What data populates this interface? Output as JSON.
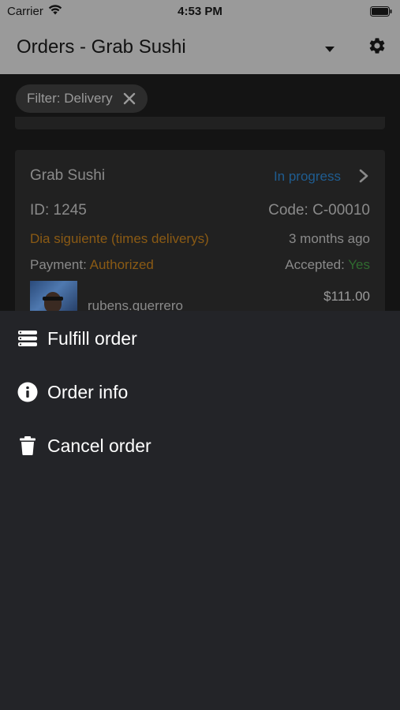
{
  "status_bar": {
    "carrier": "Carrier",
    "time": "4:53 PM"
  },
  "app_bar": {
    "title": "Orders - Grab Sushi",
    "icons": [
      "dropdown-arrow-icon",
      "gear-icon"
    ]
  },
  "filter_chip": {
    "label": "Filter: Delivery"
  },
  "order": {
    "store": "Grab Sushi",
    "status": "In progress",
    "id": "ID: 1245",
    "code": "Code: C-00010",
    "delivery": "Dia siguiente (times deliverys)",
    "time_ago": "3 months ago",
    "payment_label": "Payment:",
    "payment_value": "Authorized",
    "accepted_label": "Accepted:",
    "accepted_value": "Yes",
    "username": "rubens.guerrero",
    "price": "$111.00"
  },
  "sheet": {
    "items": [
      {
        "label": "Fulfill order",
        "icon": "list-icon"
      },
      {
        "label": "Order info",
        "icon": "info-icon"
      },
      {
        "label": "Cancel order",
        "icon": "trash-icon"
      }
    ]
  },
  "colors": {
    "status_in_progress": "#1f5d91",
    "delivery_text": "#8a5a14",
    "accepted_yes": "#2f6a2f",
    "sheet_background": "#232428"
  }
}
